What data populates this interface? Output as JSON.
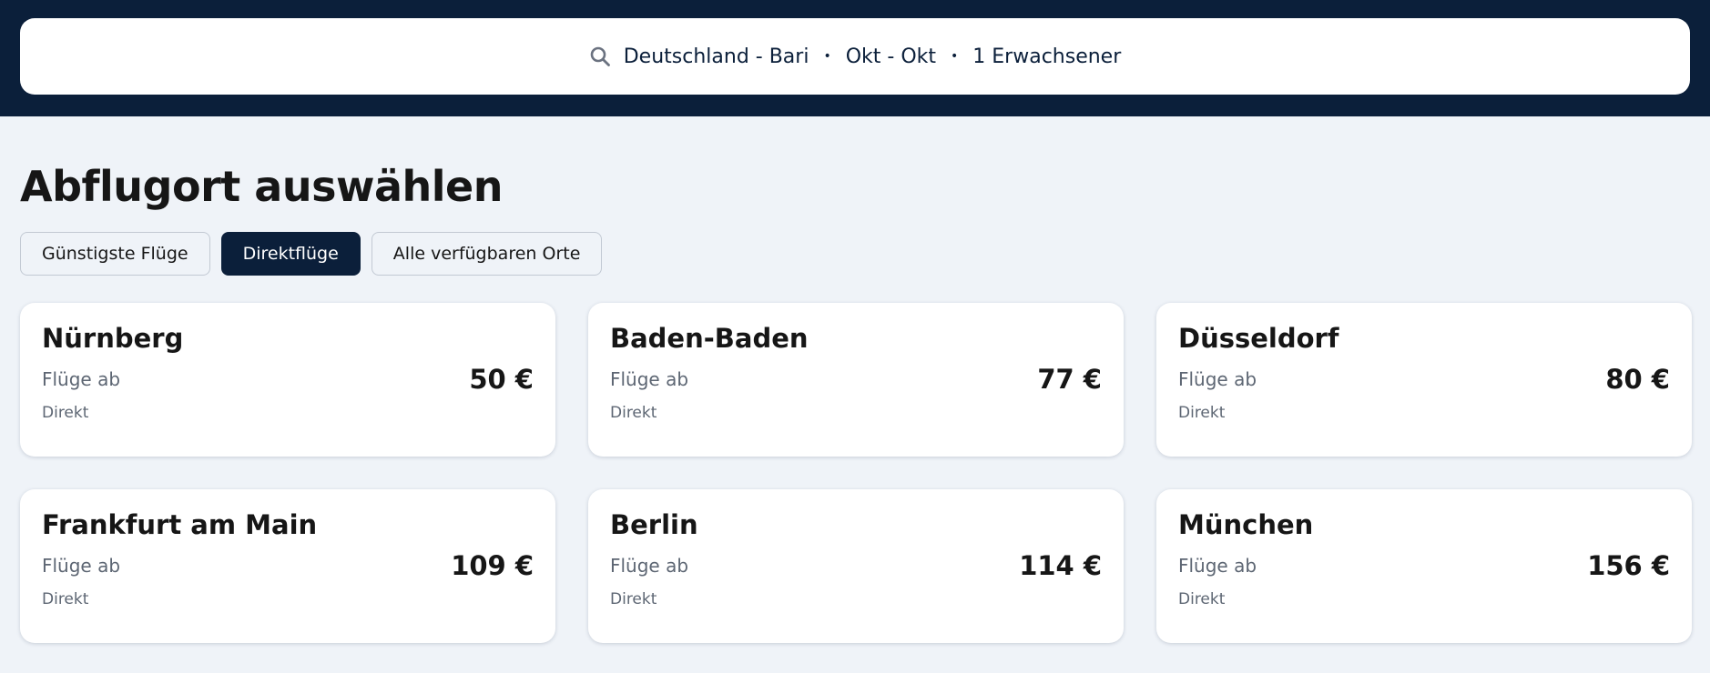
{
  "search": {
    "route": "Deutschland - Bari",
    "dates": "Okt - Okt",
    "travellers": "1 Erwachsener",
    "separator": "•",
    "icon": "search-icon"
  },
  "page_title": "Abflugort auswählen",
  "tabs": [
    {
      "label": "Günstigste Flüge",
      "active": false
    },
    {
      "label": "Direktflüge",
      "active": true
    },
    {
      "label": "Alle verfügbaren Orte",
      "active": false
    }
  ],
  "cards": [
    {
      "city": "Nürnberg",
      "from_label": "Flüge ab",
      "price": "50 €",
      "tag": "Direkt"
    },
    {
      "city": "Baden-Baden",
      "from_label": "Flüge ab",
      "price": "77 €",
      "tag": "Direkt"
    },
    {
      "city": "Düsseldorf",
      "from_label": "Flüge ab",
      "price": "80 €",
      "tag": "Direkt"
    },
    {
      "city": "Frankfurt am Main",
      "from_label": "Flüge ab",
      "price": "109 €",
      "tag": "Direkt"
    },
    {
      "city": "Berlin",
      "from_label": "Flüge ab",
      "price": "114 €",
      "tag": "Direkt"
    },
    {
      "city": "München",
      "from_label": "Flüge ab",
      "price": "156 €",
      "tag": "Direkt"
    }
  ],
  "colors": {
    "header_bg": "#0b1f3a",
    "page_bg": "#eff3f8",
    "active_tab": "#0b1f3a"
  }
}
